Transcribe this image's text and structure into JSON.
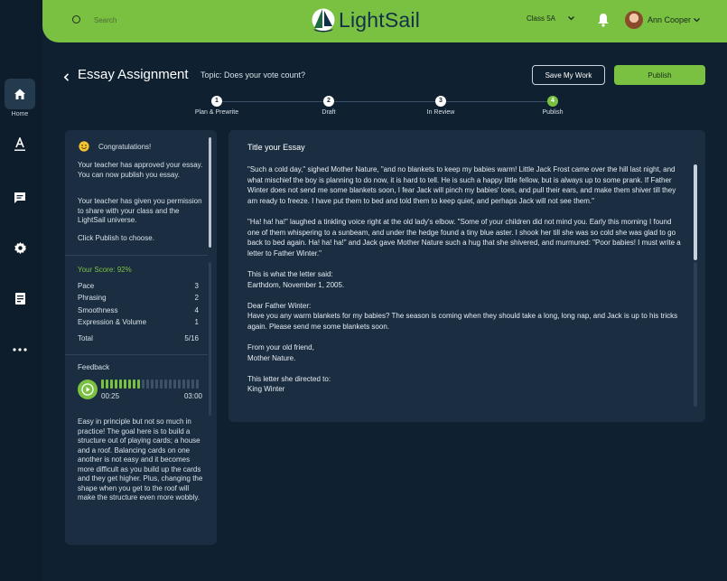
{
  "nav": {
    "items": [
      {
        "label": "Home",
        "icon": "home-icon"
      },
      {
        "label": "",
        "icon": "text-icon"
      },
      {
        "label": "",
        "icon": "message-icon"
      },
      {
        "label": "",
        "icon": "settings-icon"
      },
      {
        "label": "",
        "icon": "book-icon"
      },
      {
        "label": "",
        "icon": "more-icon"
      }
    ]
  },
  "topbar": {
    "search_placeholder": "Search",
    "logo_text": "LightSail",
    "class_label": "Class 5A",
    "user_name": "Ann Cooper"
  },
  "header": {
    "title": "Essay Assignment",
    "topic": "Topic: Does your vote count?",
    "save_label": "Save My Work",
    "publish_label": "Publish"
  },
  "stepper": [
    {
      "num": "1",
      "label": "Plan & Prewrite"
    },
    {
      "num": "2",
      "label": "Draft"
    },
    {
      "num": "3",
      "label": "In Review"
    },
    {
      "num": "4",
      "label": "Publish",
      "current": true
    }
  ],
  "feedback_panel": {
    "congrats": "Congratulations!",
    "approved": "Your teacher has approved your essay. You can now publish you essay.",
    "permission": "Your teacher has given you permission to share with your class and the LightSail universe.",
    "click": "Click Publish to choose.",
    "score_label": "Your Score: 92%",
    "scores": [
      {
        "label": "Pace",
        "value": "3"
      },
      {
        "label": "Phrasing",
        "value": "2"
      },
      {
        "label": "Smoothness",
        "value": "4"
      },
      {
        "label": "Expression & Volume",
        "value": "1"
      }
    ],
    "total_label": "Total",
    "total_value": "5/16",
    "feedback_label": "Feedback",
    "audio": {
      "elapsed": "00:25",
      "duration": "03:00",
      "progress": 0.4
    },
    "comment": "Easy in principle but not so much in practice! The goal here is to build a structure out of playing cards; a house and a roof. Balancing cards on one another is not easy and it becomes more difficult as you build up the cards and they get higher. Plus, changing the shape when you get to the roof will make the structure even more wobbly."
  },
  "essay": {
    "title_placeholder": "Title your Essay",
    "paragraphs": [
      "\"Such a cold day,\" sighed Mother Nature, \"and no blankets to keep my babies warm! Little Jack Frost came over the hill last night, and what mischief the boy is planning to do now, it is hard to tell. He is such a happy little fellow, but is always up to some prank. If Father Winter does not send me some blankets soon, I fear Jack will pinch my babies' toes, and pull their ears, and make them shiver till they am ready to freeze. I have put them to bed and told them to keep quiet, and perhaps Jack will not see them.\"",
      "\"Ha! ha! ha!\" laughed a tinkling voice right at the old lady's elbow. \"Some of your children did not mind you. Early this morning I found one of them whispering to a sunbeam, and under the hedge found a tiny blue aster. I shook her till she was so cold she was glad to go back to bed again. Ha! ha! ha!\" and Jack gave Mother Nature such a hug that she shivered, and murmured: \"Poor babies! I must write a letter to Father Winter.\"",
      "This is what the letter said:\nEarthdom, November 1, 2005.",
      "Dear Father Winter:\nHave you any warm blankets for my babies? The season is coming when they should take a long, long nap, and Jack is up to his tricks again. Please send me some blankets soon.",
      "From your old friend,\nMother Nature.",
      "This letter she directed to:\nKing Winter"
    ]
  },
  "colors": {
    "accent": "#7ac142",
    "background": "#0f2030",
    "panel": "#1b2e41",
    "rail": "#0d1d2c"
  }
}
